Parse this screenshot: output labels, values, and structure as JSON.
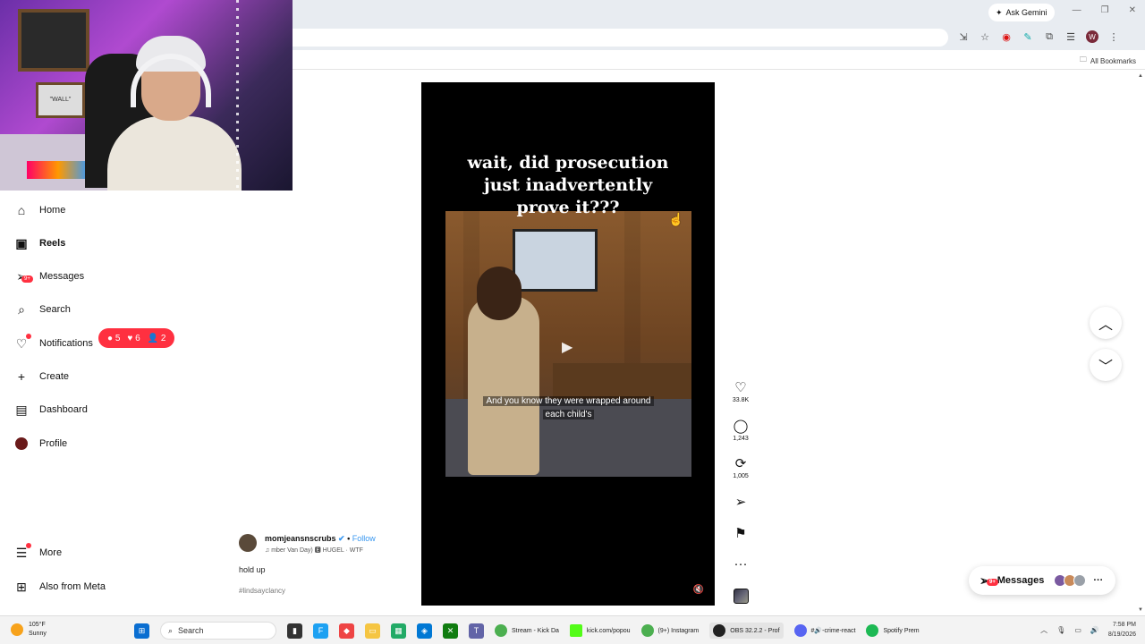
{
  "browser": {
    "ask_gemini": "Ask Gemini",
    "all_bookmarks": "All Bookmarks",
    "profile_initial": "W"
  },
  "webcam": {
    "sign_text": "\"WALL\""
  },
  "sidebar": {
    "items": [
      {
        "label": "Home",
        "icon": "home-icon"
      },
      {
        "label": "Reels",
        "icon": "reels-icon"
      },
      {
        "label": "Messages",
        "icon": "messages-icon",
        "badge": "9+"
      },
      {
        "label": "Search",
        "icon": "search-icon"
      },
      {
        "label": "Notifications",
        "icon": "heart-icon"
      },
      {
        "label": "Create",
        "icon": "plus-icon"
      },
      {
        "label": "Dashboard",
        "icon": "dashboard-icon"
      },
      {
        "label": "Profile",
        "icon": "profile-avatar"
      },
      {
        "label": "More",
        "icon": "menu-icon"
      },
      {
        "label": "Also from Meta",
        "icon": "meta-icon"
      }
    ],
    "notifications_pill": {
      "comments": "5",
      "likes": "6",
      "follows": "2"
    }
  },
  "reel": {
    "title_line1": "wait, did prosecution",
    "title_line2": "just inadvertently",
    "title_line3": "prove it???",
    "caption_line1": "And you know they were wrapped around",
    "caption_line2": "each child's"
  },
  "actions": {
    "likes": "33.8K",
    "comments": "1,243",
    "reposts": "1,005"
  },
  "author": {
    "username": "momjeansnscrubs",
    "follow": "Follow",
    "separator": "•",
    "music": "mber Van Day) 🅴 HUGEL · WTF",
    "description": "hold up",
    "hashtag": "#lindsayclancy"
  },
  "messages_pill": {
    "label": "Messages",
    "badge": "9+"
  },
  "taskbar": {
    "weather_temp": "105°F",
    "weather_desc": "Sunny",
    "search_label": "Search",
    "apps": [
      "Stream - Kick Da",
      "kick.com/popou",
      "(9+) Instagram",
      "OBS 32.2.2 - Prof",
      "#🔊-crime-react",
      "Spotify Prem"
    ],
    "time": "7:58 PM",
    "date": "8/19/2026"
  },
  "colors": {
    "accent_red": "#ff3040",
    "link_blue": "#3897f0"
  }
}
